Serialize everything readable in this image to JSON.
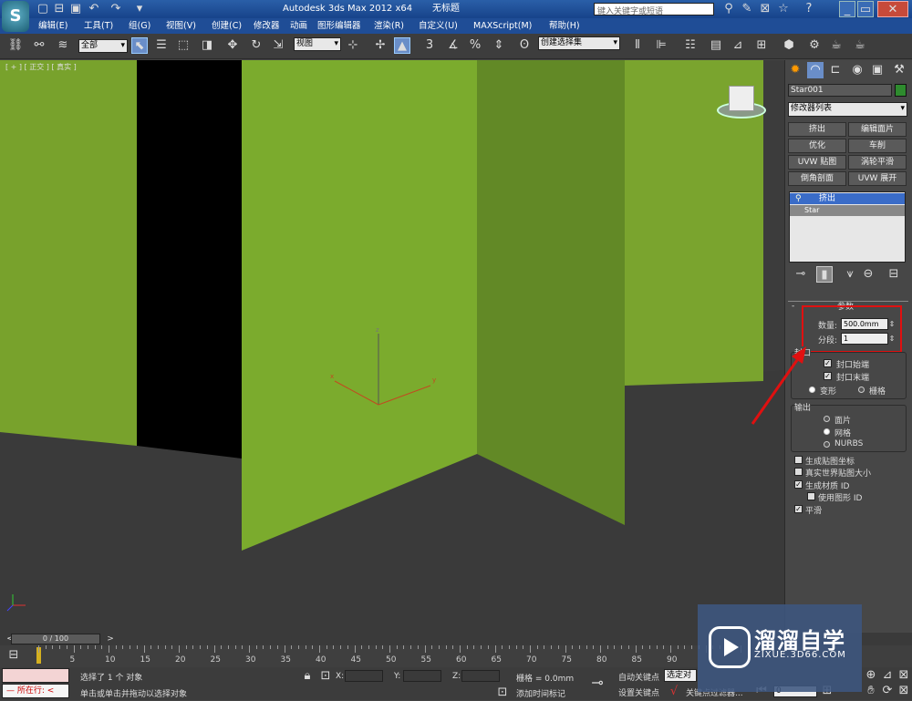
{
  "title_bar": {
    "app_title": "Autodesk 3ds Max  2012 x64",
    "doc_title": "无标题",
    "search_placeholder": "键入关键字或短语"
  },
  "menu": {
    "items": [
      "编辑(E)",
      "工具(T)",
      "组(G)",
      "视图(V)",
      "创建(C)",
      "修改器",
      "动画",
      "图形编辑器",
      "渲染(R)",
      "自定义(U)",
      "MAXScript(M)",
      "帮助(H)"
    ]
  },
  "toolbar": {
    "filter_value": "全部",
    "ref_coord_value": "视图",
    "snap_3": "3",
    "named_sel_value": "创建选择集"
  },
  "viewport": {
    "label": "[ + ] [ 正交 ] [ 真实 ]",
    "axis_x": "x",
    "axis_y": "y",
    "axis_z": "z"
  },
  "command_panel": {
    "object_name": "Star001",
    "object_color": "#2e8b2e",
    "modifier_list_label": "修改器列表",
    "modifier_buttons": [
      "挤出",
      "编辑面片",
      "优化",
      "车削",
      "UVW 贴图",
      "涡轮平滑",
      "倒角剖面",
      "UVW 展开"
    ],
    "stack": {
      "selected": "挤出",
      "base": "Star"
    },
    "params": {
      "rollout_title": "参数",
      "amount_label": "数量:",
      "amount_value": "500.0mm",
      "segments_label": "分段:",
      "segments_value": "1",
      "capping_title": "封口",
      "cap_start": "封口始端",
      "cap_end": "封口末端",
      "morph": "变形",
      "grid": "栅格",
      "output_title": "输出",
      "patch": "面片",
      "mesh": "网格",
      "nurbs": "NURBS",
      "gen_map_coords": "生成贴图坐标",
      "real_world_map": "真实世界贴图大小",
      "gen_mat_ids": "生成材质 ID",
      "use_shape_ids": "使用图形 ID",
      "smooth": "平滑"
    }
  },
  "timeline": {
    "frame_counter": "0 / 100",
    "ticks": [
      "5",
      "10",
      "15",
      "20",
      "25",
      "30",
      "35",
      "40",
      "45",
      "50",
      "55",
      "60",
      "65",
      "70",
      "75",
      "80",
      "85",
      "90"
    ]
  },
  "status_bar": {
    "maxscript_label": "所在行:",
    "status_top": "选择了 1 个 对象",
    "status_bottom": "单击或单击并拖动以选择对象",
    "x_label": "X:",
    "y_label": "Y:",
    "z_label": "Z:",
    "grid_text": "栅格 = 0.0mm",
    "add_time_tag": "添加时间标记",
    "auto_key": "自动关键点",
    "selected_value": "选定对象",
    "set_key": "设置关键点",
    "key_filters": "关键点过滤器...",
    "frame_value": "0"
  },
  "watermark": {
    "title": "溜溜自学",
    "url": "ZIXUE.3D66.COM"
  }
}
